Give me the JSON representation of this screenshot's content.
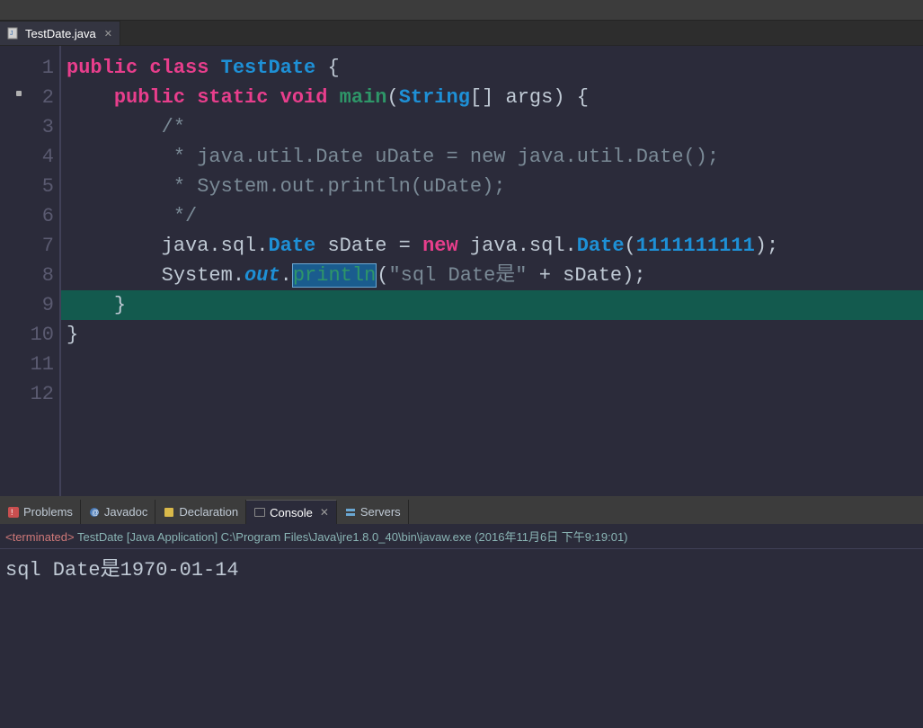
{
  "editorTab": {
    "filename": "TestDate.java",
    "closeGlyph": "✕"
  },
  "code": {
    "line1": {
      "public": "public",
      "class": "class",
      "name": "TestDate",
      "brace": " {"
    },
    "line2": {
      "indent": "    ",
      "public": "public",
      "static": "static",
      "void": "void",
      "main": "main",
      "paren_o": "(",
      "string": "String",
      "brackets": "[]",
      "args": " args",
      "paren_c": ")",
      "brace": " {"
    },
    "line3": {
      "indent": "        ",
      "text": "/*"
    },
    "line4": {
      "indent": "         ",
      "text": "* java.util.Date uDate = new java.util.Date();"
    },
    "line5": {
      "indent": "         ",
      "text": "* System.out.println(uDate);"
    },
    "line6": {
      "indent": "         ",
      "text": "*/"
    },
    "line7": {
      "indent": "        ",
      "pkg": "java.sql.",
      "date": "Date",
      "var": " sDate = ",
      "new": "new",
      "pkg2": " java.sql.",
      "date2": "Date",
      "paren_o": "(",
      "num": "1111111111",
      "paren_c": ")",
      "semi": ";"
    },
    "line8": {
      "indent": "        ",
      "sys": "System.",
      "out": "out",
      "dot": ".",
      "println": "println",
      "paren_o": "(",
      "str": "\"sql Date是\"",
      "plus": " + sDate",
      "paren_c": ")",
      "semi": ";"
    },
    "line9": {
      "text": ""
    },
    "line10": {
      "indent": "    ",
      "brace": "}"
    },
    "line11": {
      "brace": "}"
    },
    "line12": {
      "text": ""
    }
  },
  "lineNumbers": [
    "1",
    "2",
    "3",
    "4",
    "5",
    "6",
    "7",
    "8",
    "9",
    "10",
    "11",
    "12"
  ],
  "bottomTabs": {
    "problems": "Problems",
    "javadoc": "Javadoc",
    "declaration": "Declaration",
    "console": "Console",
    "servers": "Servers"
  },
  "console": {
    "terminated": "<terminated>",
    "runinfo": " TestDate [Java Application] C:\\Program Files\\Java\\jre1.8.0_40\\bin\\javaw.exe (2016年11月6日 下午9:19:01)",
    "output": "sql Date是1970-01-14"
  }
}
